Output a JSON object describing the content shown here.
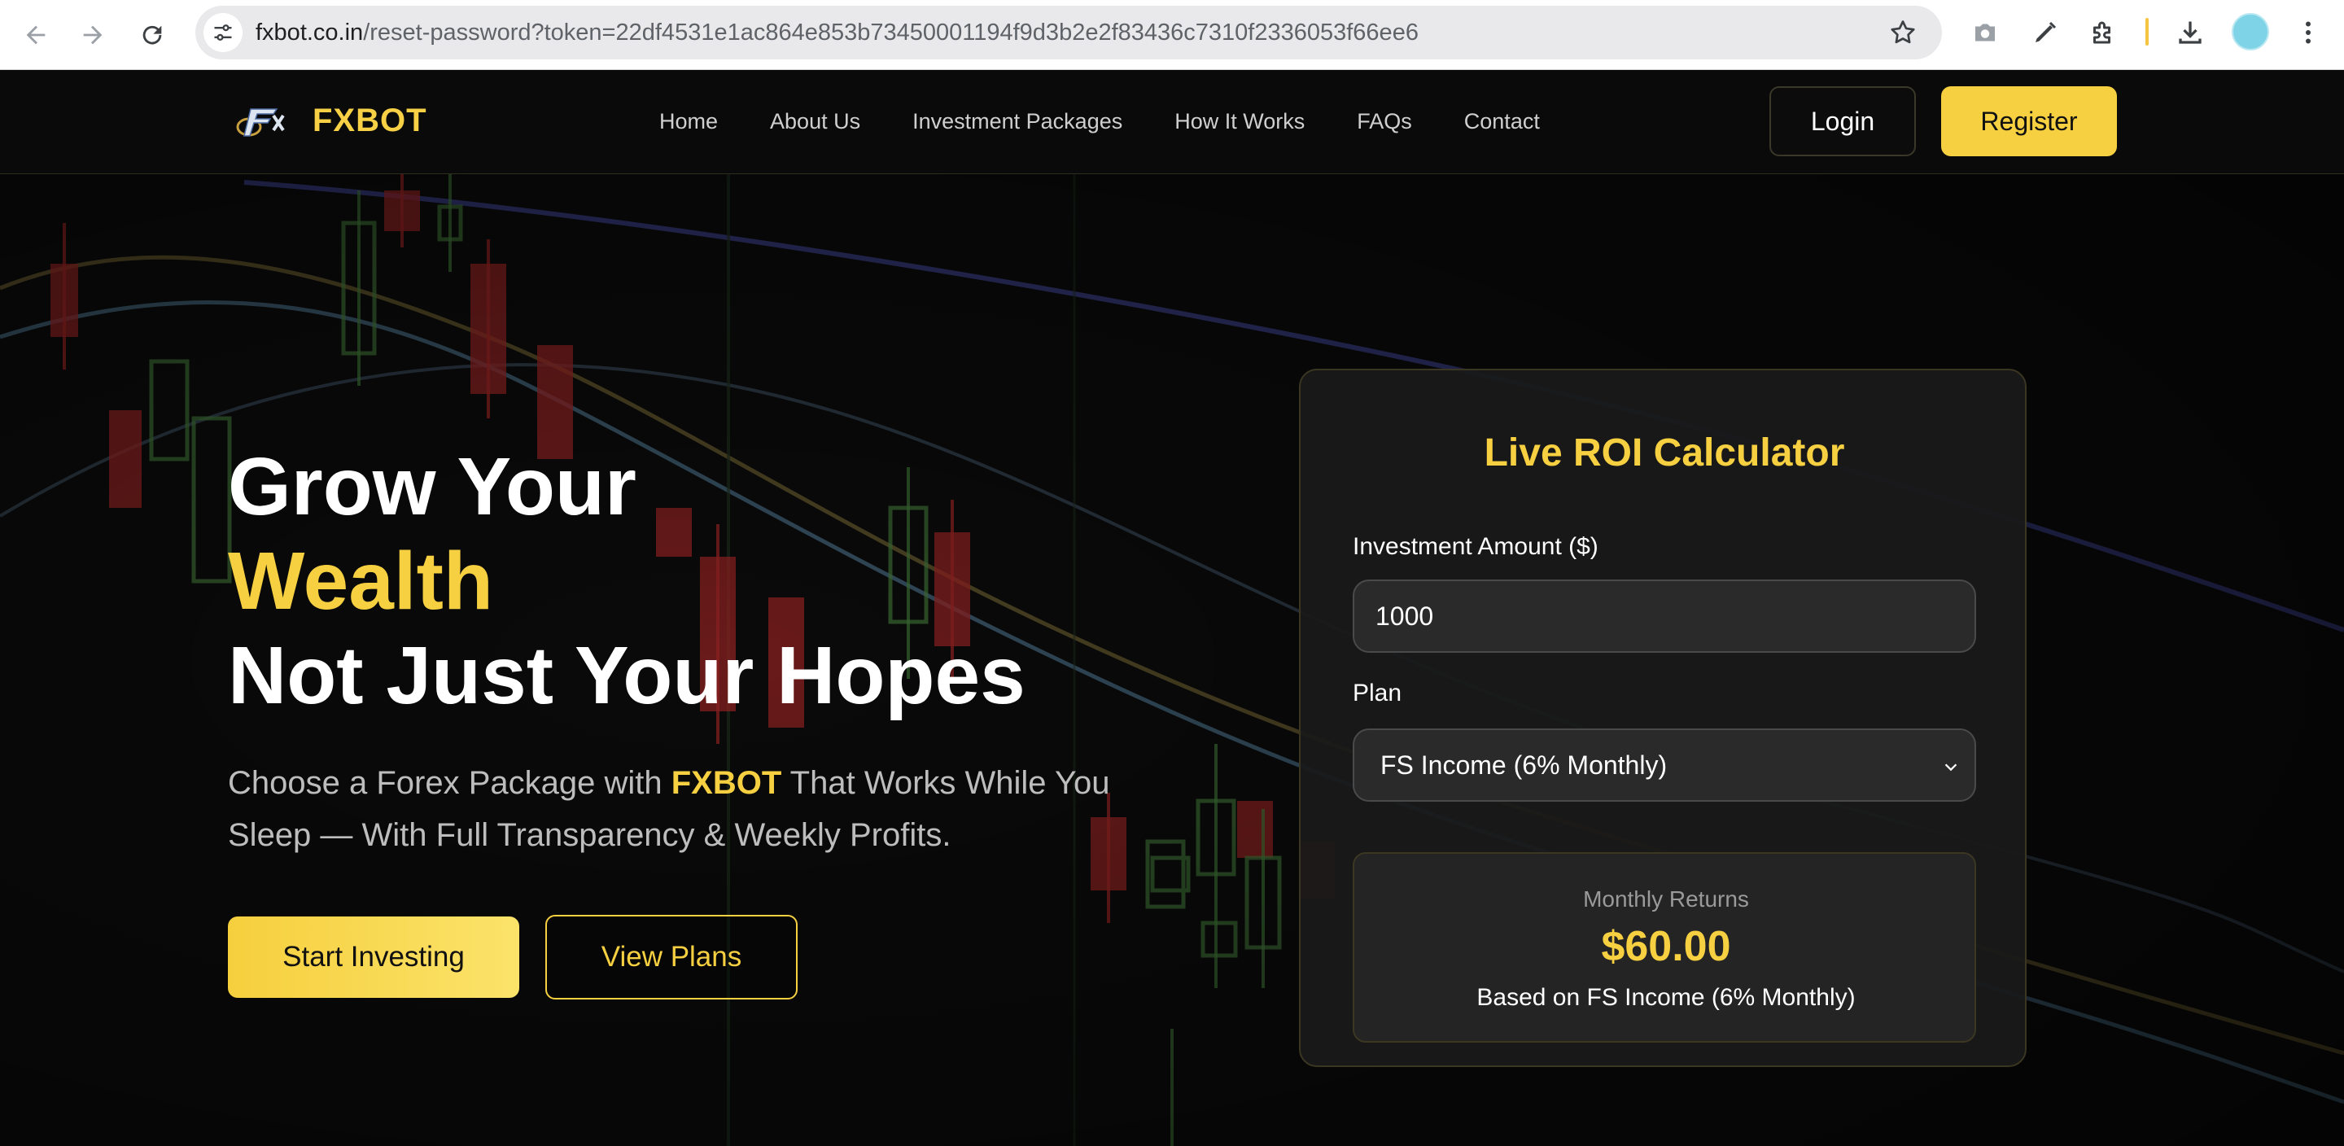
{
  "browser": {
    "url_host": "fxbot.co.in",
    "url_path": "/reset-password?token=22df4531e1ac864e853b73450001194f9d3b2e2f83436c7310f2336053f66ee6",
    "icons": [
      "back-icon",
      "forward-icon",
      "reload-icon",
      "site-info-icon",
      "bookmark-star-icon",
      "camera-icon",
      "pen-icon",
      "extensions-icon",
      "download-icon",
      "profile-avatar",
      "more-menu-icon"
    ]
  },
  "header": {
    "brand": "FXBOT",
    "menu": [
      {
        "label": "Home"
      },
      {
        "label": "About Us"
      },
      {
        "label": "Investment Packages"
      },
      {
        "label": "How It Works"
      },
      {
        "label": "FAQs"
      },
      {
        "label": "Contact"
      }
    ],
    "login_label": "Login",
    "register_label": "Register"
  },
  "hero": {
    "line1": "Grow Your",
    "line2": "Wealth",
    "line3": "Not Just Your Hopes",
    "sub_before": "Choose a Forex Package with ",
    "sub_brand": "FXBOT",
    "sub_after": " That Works While You Sleep — With Full Transparency & Weekly Profits.",
    "start_label": "Start Investing",
    "plans_label": "View Plans"
  },
  "calculator": {
    "title": "Live ROI Calculator",
    "amount_label": "Investment Amount ($)",
    "amount_value": "1000",
    "plan_label": "Plan",
    "plan_value": "FS Income (6% Monthly)",
    "returns_label": "Monthly Returns",
    "returns_value": "$60.00",
    "returns_note": "Based on FS Income (6% Monthly)"
  },
  "colors": {
    "accent": "#f6d041",
    "background": "#090909",
    "card": "#1a1a1a"
  }
}
